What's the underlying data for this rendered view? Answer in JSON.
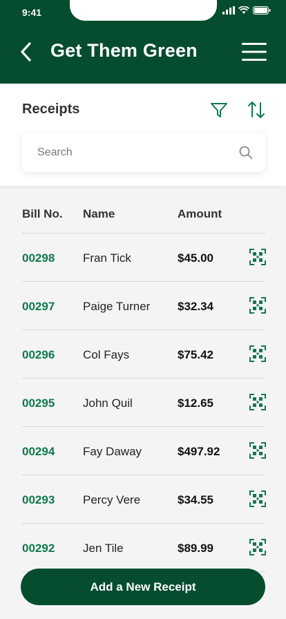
{
  "status": {
    "time": "9:41"
  },
  "header": {
    "title": "Get Them Green"
  },
  "panel": {
    "title": "Receipts",
    "search_placeholder": "Search"
  },
  "table": {
    "columns": [
      "Bill No.",
      "Name",
      "Amount"
    ],
    "rows": [
      {
        "bill": "00298",
        "name": "Fran Tick",
        "amount": "$45.00"
      },
      {
        "bill": "00297",
        "name": "Paige Turner",
        "amount": "$32.34"
      },
      {
        "bill": "00296",
        "name": "Col Fays",
        "amount": "$75.42"
      },
      {
        "bill": "00295",
        "name": "John Quil",
        "amount": "$12.65"
      },
      {
        "bill": "00294",
        "name": "Fay Daway",
        "amount": "$497.92"
      },
      {
        "bill": "00293",
        "name": "Percy Vere",
        "amount": "$34.55"
      },
      {
        "bill": "00292",
        "name": "Jen Tile",
        "amount": "$89.99"
      }
    ]
  },
  "footer": {
    "add_button_label": "Add a New Receipt"
  },
  "colors": {
    "primary": "#064d30",
    "accent": "#0e7a4b"
  },
  "icons": [
    "back-arrow-icon",
    "hamburger-menu-icon",
    "filter-icon",
    "sort-icon",
    "search-icon",
    "qr-scan-icon"
  ]
}
